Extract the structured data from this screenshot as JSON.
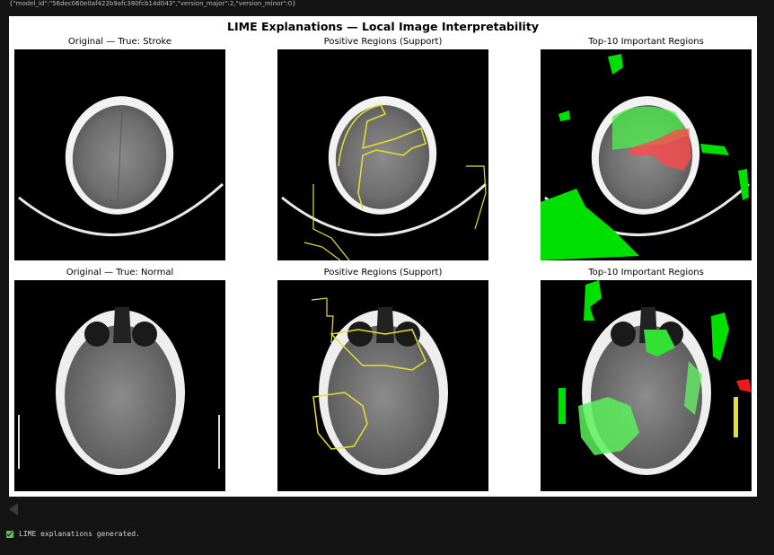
{
  "output_meta": "{\"model_id\":\"56dec060e0af422b9afc380fcb14d043\",\"version_major\":2,\"version_minor\":0}",
  "figure": {
    "title": "LIME Explanations — Local Image Interpretability",
    "row1": {
      "col1_title": "Original — True: Stroke",
      "col2_title": "Positive Regions (Support)",
      "col3_title": "Top-10 Important Regions"
    },
    "row2": {
      "col1_title": "Original — True: Normal",
      "col2_title": "Positive Regions (Support)",
      "col3_title": "Top-10 Important Regions"
    },
    "colors": {
      "boundary": "#e8e02a",
      "positive_region": "#33ff33",
      "negative_region": "#ff3333"
    }
  },
  "output_toggle": {
    "icon": "collapse-arrow-icon"
  },
  "status": {
    "icon": "checkbox-checked-icon",
    "text": "LIME explanations generated."
  }
}
